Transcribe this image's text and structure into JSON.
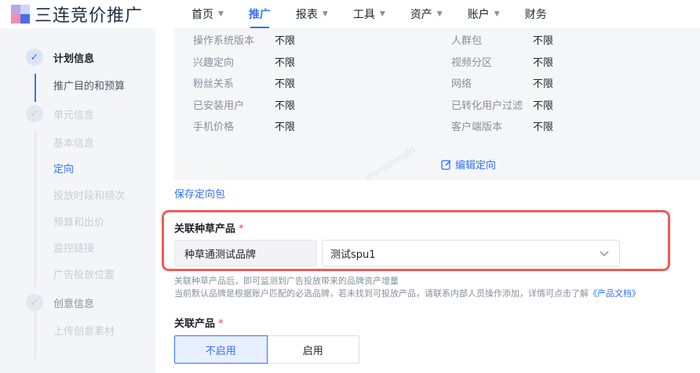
{
  "header": {
    "brand": "三连竞价推广",
    "nav": [
      {
        "label": "首页",
        "caret": true,
        "active": false
      },
      {
        "label": "推广",
        "caret": false,
        "active": true
      },
      {
        "label": "报表",
        "caret": true,
        "active": false
      },
      {
        "label": "工具",
        "caret": true,
        "active": false
      },
      {
        "label": "资产",
        "caret": true,
        "active": false
      },
      {
        "label": "账户",
        "caret": true,
        "active": false
      },
      {
        "label": "财务",
        "caret": false,
        "active": false
      }
    ]
  },
  "sidebar": {
    "plan_info": "计划信息",
    "plan_sub": "推广目的和预算",
    "unit_info": "单元信息",
    "unit_subs": [
      "基本信息",
      "定向",
      "投放时段和频次",
      "预算和出价",
      "监控链接",
      "广告投放位置"
    ],
    "creative_info": "创意信息",
    "creative_sub": "上传创意素材"
  },
  "targeting": {
    "rows_left": [
      {
        "label": "操作系统版本",
        "value": "不限"
      },
      {
        "label": "兴趣定向",
        "value": "不限"
      },
      {
        "label": "粉丝关系",
        "value": "不限"
      },
      {
        "label": "已安装用户",
        "value": "不限"
      },
      {
        "label": "手机价格",
        "value": "不限"
      }
    ],
    "rows_right": [
      {
        "label": "人群包",
        "value": "不限"
      },
      {
        "label": "视频分区",
        "value": "不限"
      },
      {
        "label": "网络",
        "value": "不限"
      },
      {
        "label": "已转化用户过滤",
        "value": "不限"
      },
      {
        "label": "客户端版本",
        "value": "不限"
      }
    ],
    "edit_label": "编辑定向",
    "save_label": "保存定向包"
  },
  "product_link": {
    "label": "关联种草产品",
    "required_mark": "*",
    "brand_value": "种草通测试品牌",
    "select_value": "测试spu1",
    "help_line1": "关联种草产品后，即可监测到广告投放带来的品牌资产增量",
    "help_line2": "当前默认品牌是根据账户匹配的必选品牌，若未找到可投放产品，请联系内部人员操作添加，详情可点击了解",
    "help_doc_link": "《产品文档》"
  },
  "related_product": {
    "label": "关联产品",
    "required_mark": "*",
    "options": [
      "不启用",
      "启用"
    ],
    "selected": "不启用"
  },
  "watermark": "zhangcheng01",
  "colors": {
    "accent": "#3370ff",
    "highlight": "#ee5b55",
    "required": "#f53f3f"
  }
}
